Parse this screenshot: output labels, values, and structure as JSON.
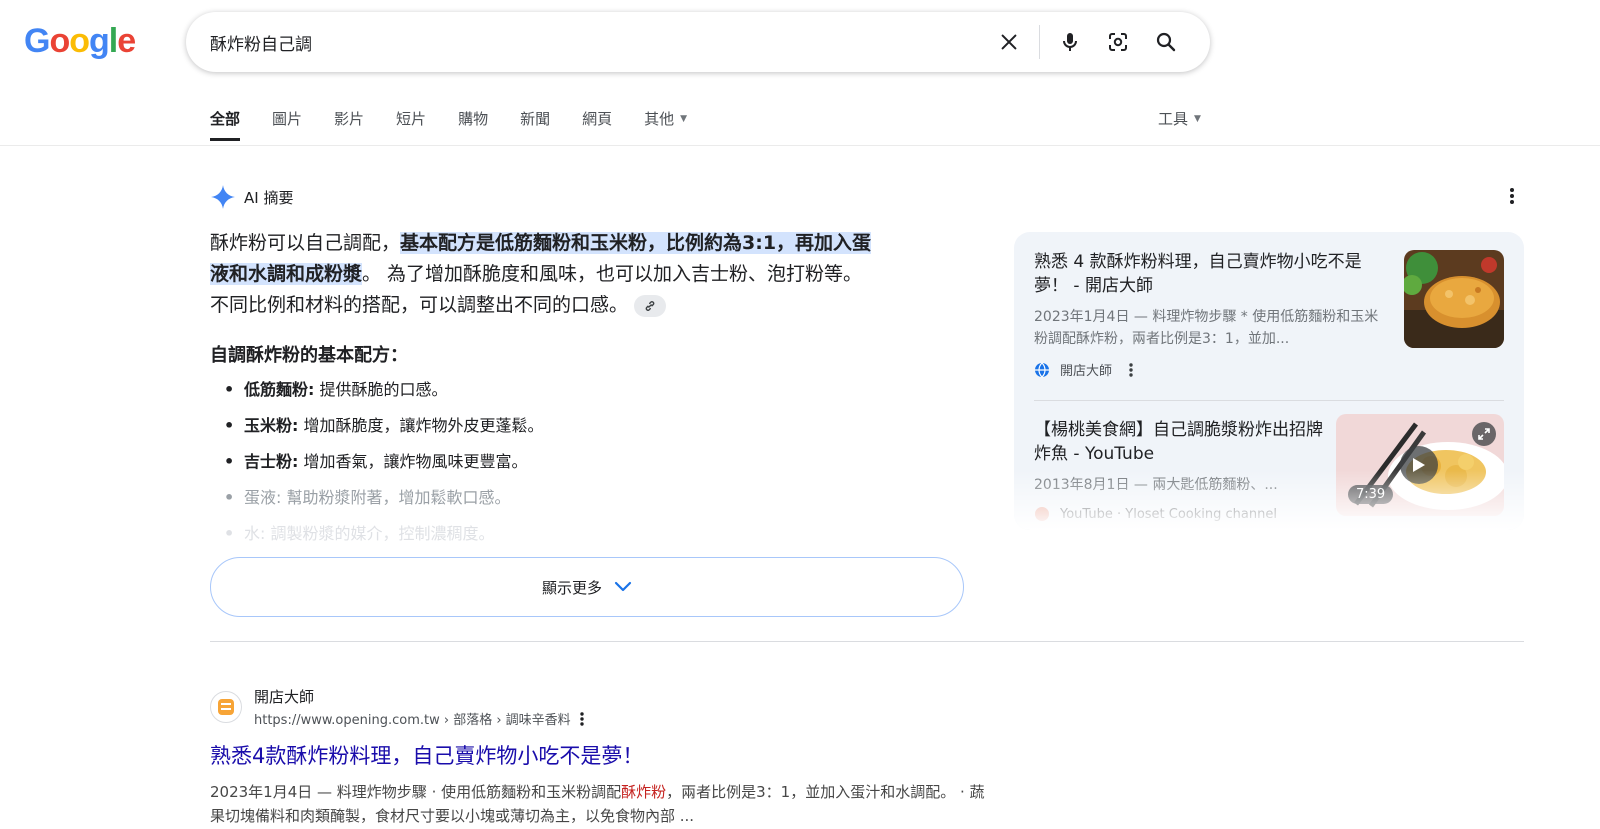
{
  "logo": {
    "g1": "G",
    "o1": "o",
    "o2": "o",
    "g2": "g",
    "l": "l",
    "e": "e"
  },
  "search": {
    "query": "酥炸粉自己調"
  },
  "tabs": [
    {
      "label": "全部"
    },
    {
      "label": "圖片"
    },
    {
      "label": "影片"
    },
    {
      "label": "短片"
    },
    {
      "label": "購物"
    },
    {
      "label": "新聞"
    },
    {
      "label": "網頁"
    },
    {
      "label": "其他"
    }
  ],
  "tools_label": "工具",
  "ai": {
    "label": "AI 摘要",
    "p_start": "酥炸粉可以自己調配，",
    "p_highlight_1": "基本配方是低筋麵粉和玉米粉，比例約為3:1，再加入蛋",
    "p_highlight_2": "液和水調和成粉漿",
    "p_rest_1": "。 為了增加酥脆度和風味，也可以加入吉士粉、泡打粉等。",
    "p_rest_2": "不同比例和材料的搭配，可以調整出不同的口感。",
    "subhead": "自調酥炸粉的基本配方：",
    "items": [
      {
        "term": "低筋麵粉:",
        "desc": " 提供酥脆的口感。"
      },
      {
        "term": "玉米粉:",
        "desc": " 增加酥脆度，讓炸物外皮更蓬鬆。"
      },
      {
        "term": "吉士粉:",
        "desc": " 增加香氣，讓炸物風味更豐富。"
      },
      {
        "term": "蛋液:",
        "desc": " 幫助粉漿附著，增加鬆軟口感。"
      },
      {
        "term": "水:",
        "desc": " 調製粉漿的媒介，控制濃稠度。"
      }
    ],
    "show_more": "顯示更多"
  },
  "side_cards": [
    {
      "title": "熟悉 4 款酥炸粉料理，自己賣炸物小吃不是夢！ - 開店大師",
      "snippet": "2023年1月4日 — 料理炸物步驟 * 使用低筋麵粉和玉米粉調配酥炸粉，兩者比例是3：1，並加...",
      "source": "開店大師"
    },
    {
      "title": "【楊桃美食網】自己調脆漿粉炸出招牌炸魚 - YouTube",
      "snippet": "2013年8月1日 — 兩大匙低筋麵粉、...",
      "source": "YouTube · Yloset Cooking channel",
      "duration": "7:39"
    }
  ],
  "result": {
    "site_name": "開店大師",
    "url": "https://www.opening.com.tw › 部落格 › 調味辛香料",
    "title": "熟悉4款酥炸粉料理，自己賣炸物小吃不是夢！",
    "snippet_1": "2023年1月4日 — 料理炸物步驟 · 使用低筋麵粉和玉米粉調配",
    "snippet_em": "酥炸粉",
    "snippet_2": "，兩者比例是3：1，並加入蛋汁和水調配。 · 蔬果切塊備料和肉類醃製，食材尺寸要以小塊或薄切為主，以免食物內部 ..."
  }
}
